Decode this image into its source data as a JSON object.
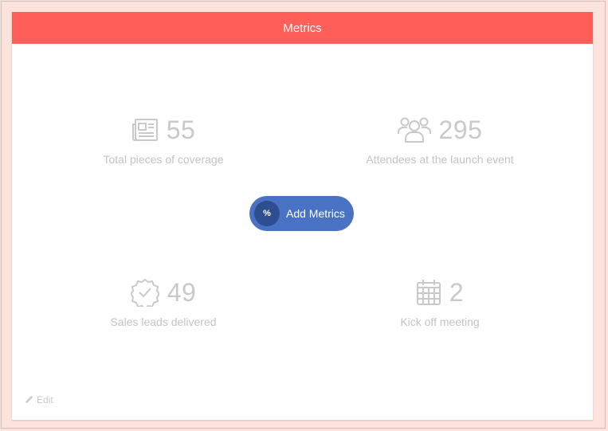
{
  "header": {
    "title": "Metrics"
  },
  "metrics": [
    {
      "value": "55",
      "label": "Total pieces of coverage",
      "icon": "newspaper-icon"
    },
    {
      "value": "295",
      "label": "Attendees at the launch event",
      "icon": "people-icon"
    },
    {
      "value": "49",
      "label": "Sales leads delivered",
      "icon": "badge-check-icon"
    },
    {
      "value": "2",
      "label": "Kick off meeting",
      "icon": "calendar-icon"
    }
  ],
  "add_button": {
    "label": "Add Metrics",
    "icon_text": "%",
    "icon": "percent-icon"
  },
  "edit": {
    "label": "Edit",
    "icon": "pencil-icon"
  },
  "colors": {
    "header": "#ff5f58",
    "button": "#4a72c4",
    "button_circle": "#2e4f8f",
    "background": "#fde3dc"
  }
}
